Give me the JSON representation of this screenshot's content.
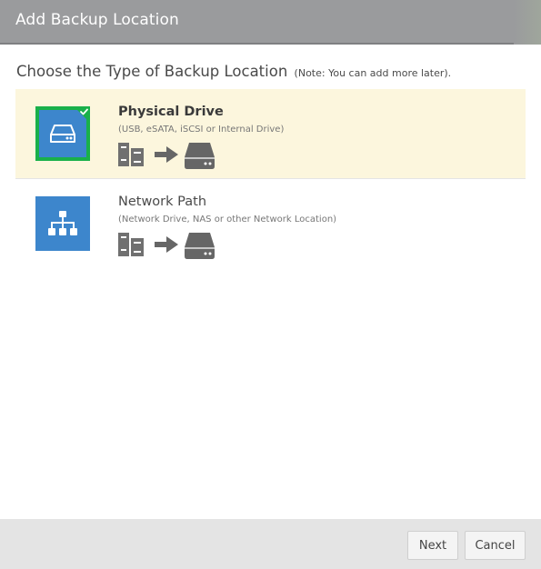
{
  "window": {
    "title": "Add Backup Location"
  },
  "heading": {
    "text": "Choose the Type of Backup Location",
    "note": "(Note: You can add more later)."
  },
  "options": [
    {
      "title": "Physical Drive",
      "subtitle": "(USB, eSATA, iSCSI or Internal Drive)",
      "icon": "hard-drive-icon",
      "selected": true
    },
    {
      "title": "Network Path",
      "subtitle": "(Network Drive, NAS or other Network Location)",
      "icon": "network-icon",
      "selected": false
    }
  ],
  "footer": {
    "next_label": "Next",
    "cancel_label": "Cancel"
  },
  "colors": {
    "titlebar": "#9a9b9d",
    "tile_blue": "#3d86cc",
    "selected_border": "#19b04a",
    "selected_bg": "#fcf6dd",
    "footer_bg": "#e4e4e4",
    "icon_gray": "#666666"
  }
}
